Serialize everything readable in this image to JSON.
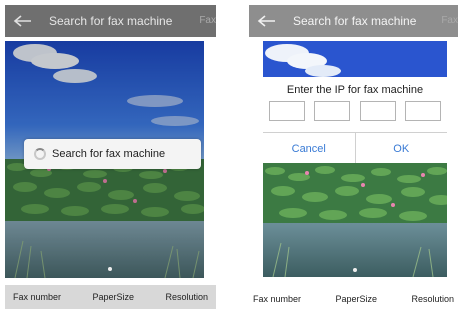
{
  "screens": [
    {
      "header": {
        "title": "Search for fax machine",
        "tab_peek": "Fax"
      },
      "toast": {
        "text": "Search for fax machine"
      },
      "footer": {
        "items": [
          "Fax number",
          "PaperSize",
          "Resolution"
        ]
      }
    },
    {
      "header": {
        "title": "Search for fax machine",
        "tab_peek": "Fax"
      },
      "dialog": {
        "title": "Enter the IP for fax machine",
        "cancel": "Cancel",
        "ok": "OK"
      },
      "footer": {
        "items": [
          "Fax number",
          "PaperSize",
          "Resolution"
        ]
      }
    }
  ],
  "colors": {
    "accent": "#3a7bd5",
    "header_left": "#6f6f6f",
    "header_right": "#8e8e8e"
  }
}
